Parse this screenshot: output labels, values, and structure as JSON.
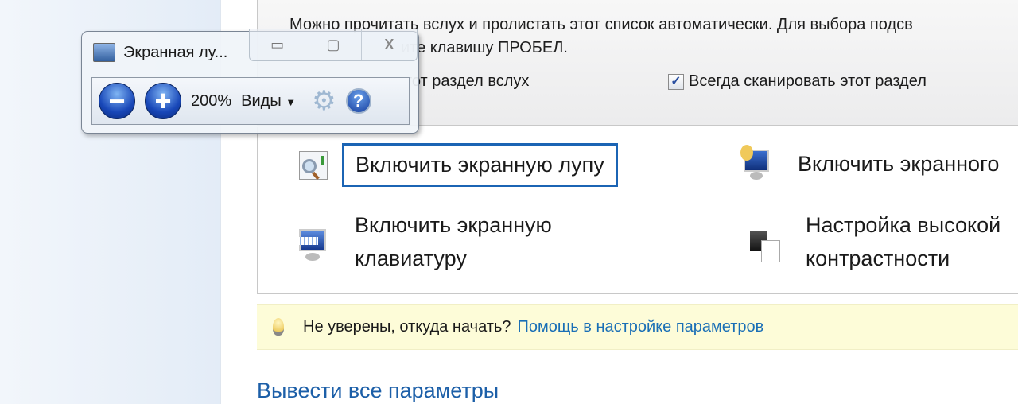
{
  "description": {
    "line1": "Можно прочитать вслух и пролистать этот список автоматически. Для выбора подсв",
    "line2": "ите клавишу ПРОБЕЛ."
  },
  "options": {
    "read_aloud": "ть этот раздел вслух",
    "always_scan": "Всегда сканировать этот раздел",
    "always_scan_checked": true
  },
  "items": [
    {
      "label": "Включить экранную лупу",
      "icon": "magnifier-icon"
    },
    {
      "label": "Включить экранного",
      "icon": "narrator-icon"
    },
    {
      "label_line1": "Включить экранную",
      "label_line2": "клавиатуру",
      "icon": "keyboard-icon"
    },
    {
      "label_line1": "Настройка высокой",
      "label_line2": "контрастности",
      "icon": "contrast-icon"
    }
  ],
  "tip": {
    "text": "Не уверены, откуда начать?",
    "link": "Помощь в настройке параметров"
  },
  "all_settings": "Вывести все параметры",
  "magnifier": {
    "title": "Экранная лу...",
    "zoom": "200%",
    "views": "Виды",
    "minimize": "▭",
    "maximize": "▢",
    "close": "X"
  }
}
